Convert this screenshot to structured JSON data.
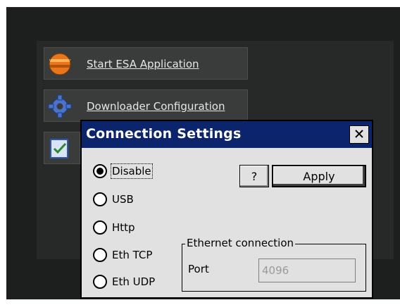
{
  "launcher": {
    "items": [
      {
        "label": "Start ESA Application",
        "icon": "orange-sphere-icon"
      },
      {
        "label": "Downloader Configuration",
        "icon": "gear-icon"
      },
      {
        "label": "",
        "icon": "checklist-icon"
      }
    ]
  },
  "dialog": {
    "title": "Connection Settings",
    "close_label": "✕",
    "radios": [
      {
        "label": "Disable",
        "checked": true
      },
      {
        "label": "USB",
        "checked": false
      },
      {
        "label": "Http",
        "checked": false
      },
      {
        "label": "Eth TCP",
        "checked": false
      },
      {
        "label": "Eth UDP",
        "checked": false
      }
    ],
    "help_label": "?",
    "apply_label": "Apply",
    "ethernet": {
      "group_label": "Ethernet connection",
      "port_label": "Port",
      "port_value": "4096"
    }
  },
  "colors": {
    "titlebar": "#0b246b",
    "dialog_bg": "#e1e1e1",
    "screen_bg": "#1d1e1e"
  }
}
